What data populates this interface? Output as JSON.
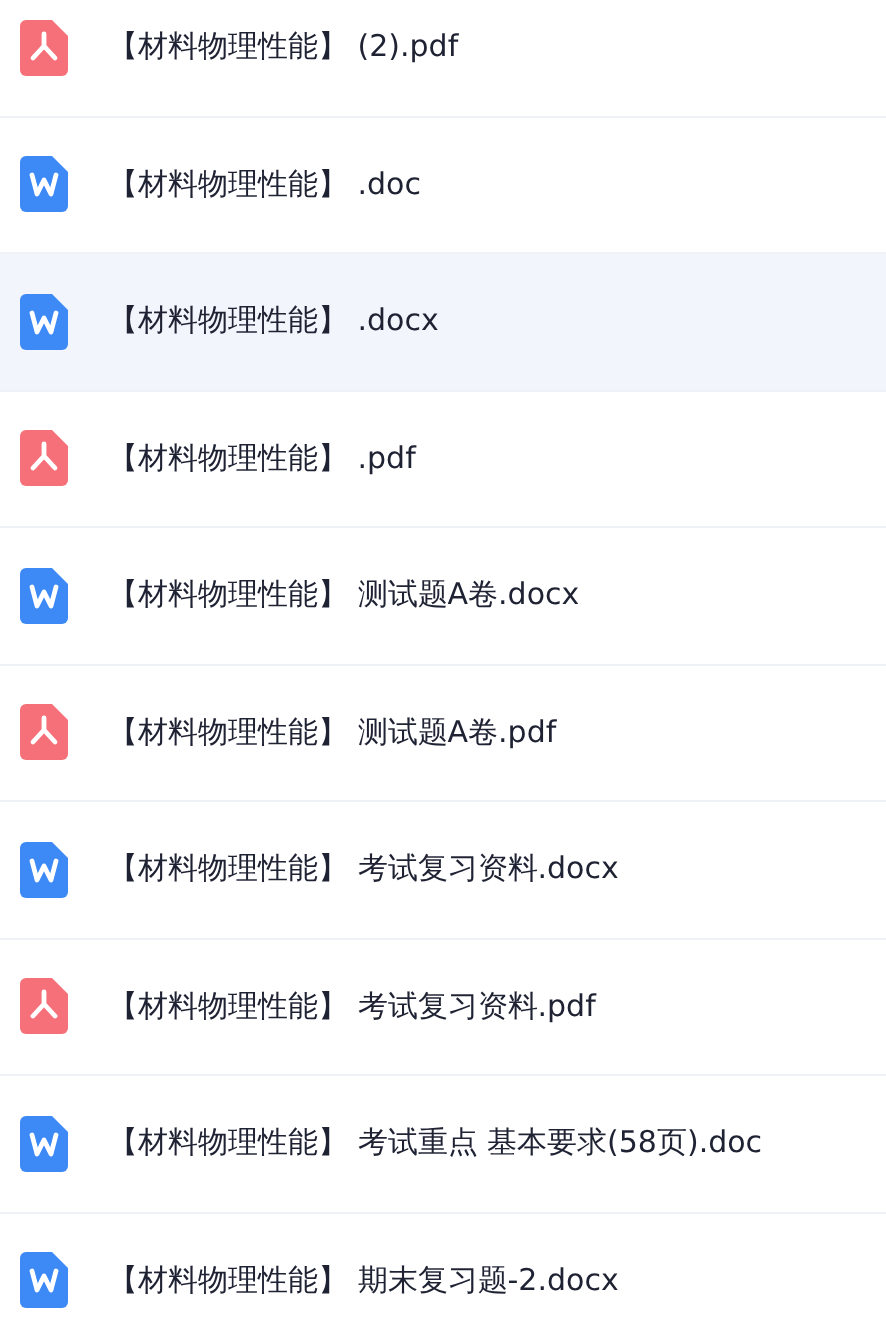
{
  "files": [
    {
      "kind": "pdf",
      "name": "【材料物理性能】 (2).pdf",
      "selected": false
    },
    {
      "kind": "word",
      "name": "【材料物理性能】 .doc",
      "selected": false
    },
    {
      "kind": "word",
      "name": "【材料物理性能】 .docx",
      "selected": true
    },
    {
      "kind": "pdf",
      "name": "【材料物理性能】 .pdf",
      "selected": false
    },
    {
      "kind": "word",
      "name": "【材料物理性能】 测试题A卷.docx",
      "selected": false
    },
    {
      "kind": "pdf",
      "name": "【材料物理性能】 测试题A卷.pdf",
      "selected": false
    },
    {
      "kind": "word",
      "name": "【材料物理性能】 考试复习资料.docx",
      "selected": false
    },
    {
      "kind": "pdf",
      "name": "【材料物理性能】 考试复习资料.pdf",
      "selected": false
    },
    {
      "kind": "word",
      "name": "【材料物理性能】 考试重点 基本要求(58页).doc",
      "selected": false
    },
    {
      "kind": "word",
      "name": "【材料物理性能】 期末复习题-2.docx",
      "selected": false
    }
  ]
}
